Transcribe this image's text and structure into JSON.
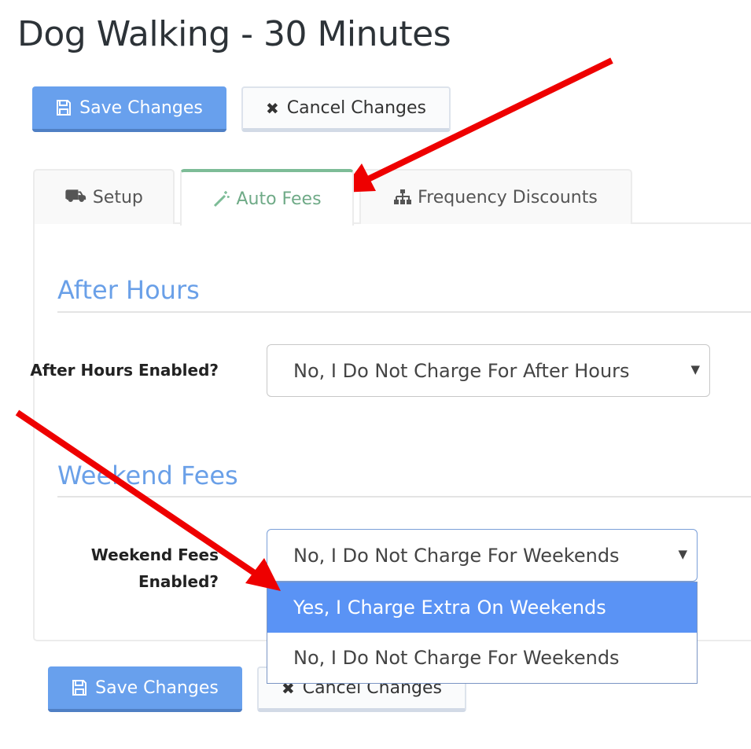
{
  "title": "Dog Walking - 30 Minutes",
  "toolbar": {
    "save_label": "Save Changes",
    "cancel_label": "Cancel Changes"
  },
  "tabs": [
    {
      "label": "Setup",
      "icon": "road-icon"
    },
    {
      "label": "Auto Fees",
      "icon": "magic-wand-icon",
      "active": true
    },
    {
      "label": "Frequency Discounts",
      "icon": "sitemap-icon"
    }
  ],
  "after_hours": {
    "heading": "After Hours",
    "label": "After Hours Enabled?",
    "value": "No, I Do Not Charge For After Hours"
  },
  "weekend": {
    "heading": "Weekend Fees",
    "label": "Weekend Fees Enabled?",
    "value": "No, I Do Not Charge For Weekends",
    "options": [
      "Yes, I Charge Extra On Weekends",
      "No, I Do Not Charge For Weekends"
    ],
    "highlighted": "Yes, I Charge Extra On Weekends"
  },
  "colors": {
    "primary": "#68a0ed",
    "accent_tab": "#7dbc97",
    "heading": "#6aa0e8",
    "highlight": "#5a93f5",
    "arrow": "#ee0000"
  }
}
